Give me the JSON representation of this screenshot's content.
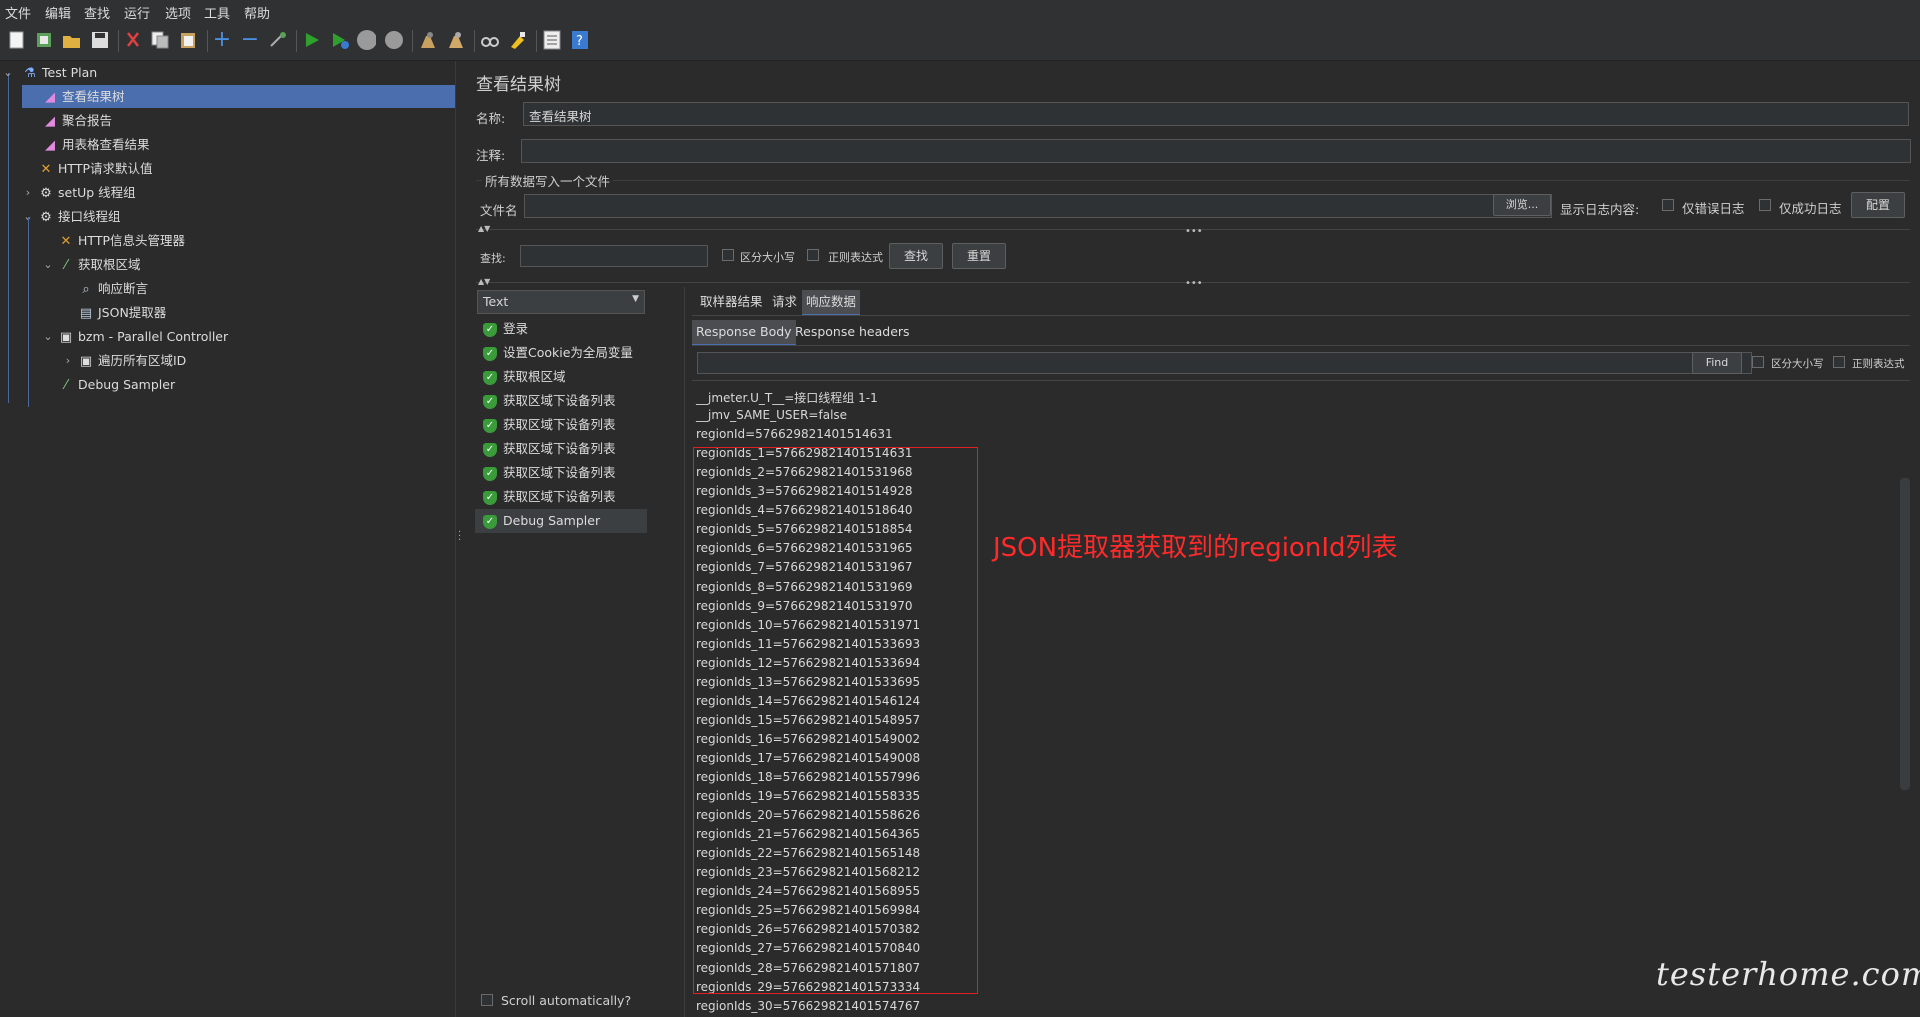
{
  "menu": [
    "文件",
    "编辑",
    "查找",
    "运行",
    "选项",
    "工具",
    "帮助"
  ],
  "toolbar_icons": [
    "new-icon",
    "template-icon",
    "open-icon",
    "save-icon",
    "cut-icon",
    "copy-icon",
    "paste-icon",
    "expand-icon",
    "collapse-icon",
    "toggle-icon",
    "start-icon",
    "start-no-pause-icon",
    "stop-icon",
    "shutdown-icon",
    "clear-icon",
    "clear-all-icon",
    "search-icon",
    "reset-search-icon",
    "function-helper-icon",
    "help-icon"
  ],
  "tree": [
    {
      "label": "Test Plan",
      "icon": "flask-icon"
    },
    {
      "label": "查看结果树",
      "icon": "chart-icon"
    },
    {
      "label": "聚合报告",
      "icon": "chart-icon"
    },
    {
      "label": "用表格查看结果",
      "icon": "chart-icon"
    },
    {
      "label": "HTTP请求默认值",
      "icon": "tools-icon"
    },
    {
      "label": "setUp 线程组",
      "icon": "gear-icon"
    },
    {
      "label": "接口线程组",
      "icon": "gear-icon"
    },
    {
      "label": "HTTP信息头管理器",
      "icon": "tools-icon"
    },
    {
      "label": "获取根区域",
      "icon": "pipette-icon"
    },
    {
      "label": "响应断言",
      "icon": "magnifier-icon"
    },
    {
      "label": "JSON提取器",
      "icon": "document-icon"
    },
    {
      "label": "bzm - Parallel Controller",
      "icon": "controller-icon"
    },
    {
      "label": "遍历所有区域ID",
      "icon": "controller-icon"
    },
    {
      "label": "Debug Sampler",
      "icon": "pipette-icon"
    }
  ],
  "panel": {
    "title": "查看结果树",
    "name_label": "名称:",
    "name_value": "查看结果树",
    "comment_label": "注释:",
    "comment_value": "",
    "file_group_label": "所有数据写入一个文件",
    "filename_label": "文件名",
    "filename_value": "",
    "browse_label": "浏览...",
    "log_label": "显示日志内容:",
    "errors_only": "仅错误日志",
    "success_only": "仅成功日志",
    "configure": "配置",
    "search_label": "查找:",
    "search_value": "",
    "case_sensitive": "区分大小写",
    "regex": "正则表达式",
    "find_btn": "查找",
    "reset_btn": "重置"
  },
  "renderer": {
    "selected": "Text"
  },
  "samples": [
    "登录",
    "设置Cookie为全局变量",
    "获取根区域",
    "获取区域下设备列表",
    "获取区域下设备列表",
    "获取区域下设备列表",
    "获取区域下设备列表",
    "获取区域下设备列表",
    "Debug Sampler"
  ],
  "scroll_auto": "Scroll automatically?",
  "tabs": [
    "取样器结果",
    "请求",
    "响应数据"
  ],
  "subtabs": [
    "Response Body",
    "Response headers"
  ],
  "find": {
    "value": "",
    "button": "Find",
    "case_sensitive": "区分大小写",
    "regex": "正则表达式"
  },
  "response_lines": [
    "__jmeter.U_T__=接口线程组 1-1",
    "__jmv_SAME_USER=false",
    "regionId=576629821401514631",
    "regionIds_1=576629821401514631",
    "regionIds_2=576629821401531968",
    "regionIds_3=576629821401514928",
    "regionIds_4=576629821401518640",
    "regionIds_5=576629821401518854",
    "regionIds_6=576629821401531965",
    "regionIds_7=576629821401531967",
    "regionIds_8=576629821401531969",
    "regionIds_9=576629821401531970",
    "regionIds_10=576629821401531971",
    "regionIds_11=576629821401533693",
    "regionIds_12=576629821401533694",
    "regionIds_13=576629821401533695",
    "regionIds_14=576629821401546124",
    "regionIds_15=576629821401548957",
    "regionIds_16=576629821401549002",
    "regionIds_17=576629821401549008",
    "regionIds_18=576629821401557996",
    "regionIds_19=576629821401558335",
    "regionIds_20=576629821401558626",
    "regionIds_21=576629821401564365",
    "regionIds_22=576629821401565148",
    "regionIds_23=576629821401568212",
    "regionIds_24=576629821401568955",
    "regionIds_25=576629821401569984",
    "regionIds_26=576629821401570382",
    "regionIds_27=576629821401570840",
    "regionIds_28=576629821401571807",
    "regionIds_29=576629821401573334",
    "regionIds_30=576629821401574767"
  ],
  "annotation": "JSON提取器获取到的regionId列表",
  "watermark": "testerhome.com",
  "colors": {
    "selection": "#4b6eaf",
    "annotation": "#ff2a2a",
    "success": "#3a9b3a"
  }
}
